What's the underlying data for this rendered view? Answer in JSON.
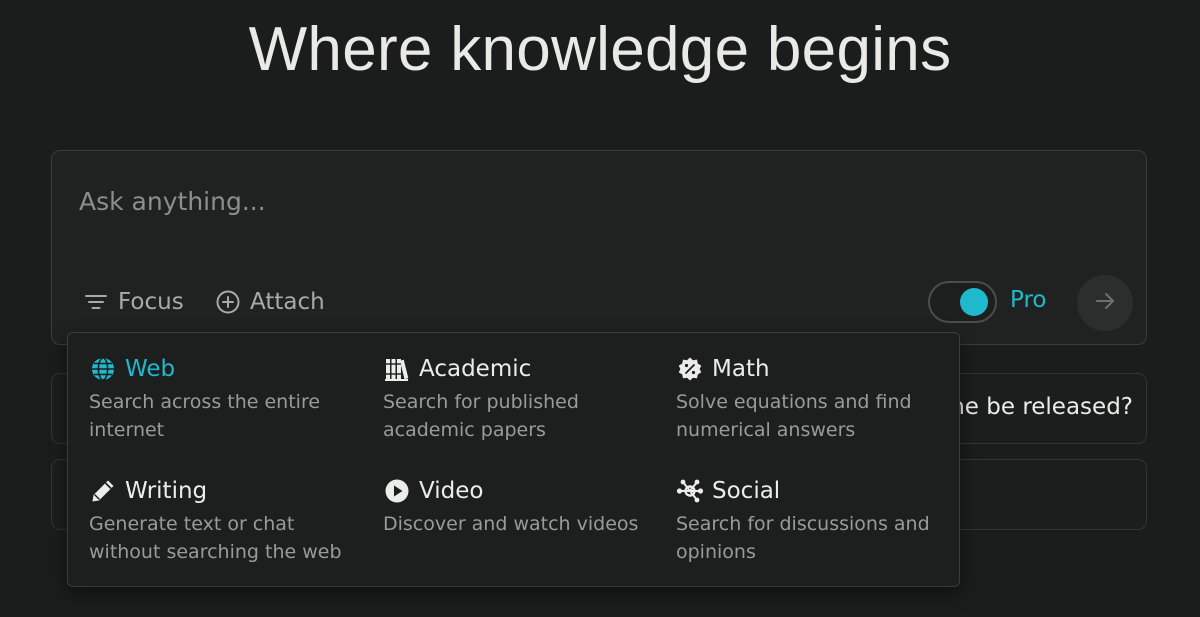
{
  "headline": "Where knowledge begins",
  "search": {
    "placeholder": "Ask anything...",
    "value": "",
    "focus_label": "Focus",
    "attach_label": "Attach",
    "pro_label": "Pro",
    "pro_enabled": true
  },
  "suggestions": [
    {
      "text": "ne be released?"
    },
    {
      "text": ""
    }
  ],
  "focus_menu": {
    "options": [
      {
        "icon": "globe-icon",
        "title": "Web",
        "desc": "Search across the entire internet",
        "active": true
      },
      {
        "icon": "books-icon",
        "title": "Academic",
        "desc": "Search for published academic papers",
        "active": false
      },
      {
        "icon": "math-badge-icon",
        "title": "Math",
        "desc": "Solve equations and find numerical answers",
        "active": false
      },
      {
        "icon": "pencil-icon",
        "title": "Writing",
        "desc": "Generate text or chat without searching the web",
        "active": false
      },
      {
        "icon": "play-circle-icon",
        "title": "Video",
        "desc": "Discover and watch videos",
        "active": false
      },
      {
        "icon": "network-icon",
        "title": "Social",
        "desc": "Search for discussions and opinions",
        "active": false
      }
    ]
  },
  "colors": {
    "background": "#1b1c1c",
    "accent": "#20b8cd",
    "text": "#e8e8e6",
    "muted": "#9a9b99"
  }
}
